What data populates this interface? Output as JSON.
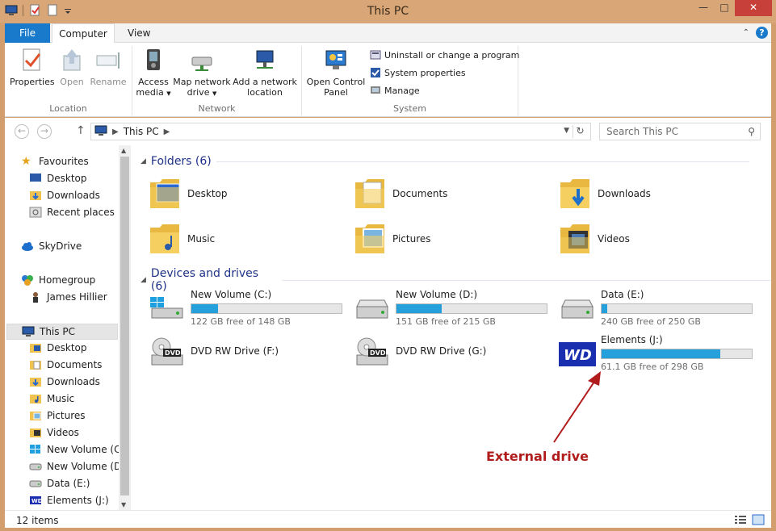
{
  "window": {
    "title": "This PC"
  },
  "ribbon_tabs": {
    "file": "File",
    "computer": "Computer",
    "view": "View"
  },
  "ribbon": {
    "location": {
      "label": "Location",
      "properties": "Properties",
      "open": "Open",
      "rename": "Rename"
    },
    "network": {
      "label": "Network",
      "access_media_1": "Access",
      "access_media_2": "media",
      "map_drive_1": "Map network",
      "map_drive_2": "drive",
      "add_location_1": "Add a network",
      "add_location_2": "location"
    },
    "system": {
      "label": "System",
      "open_cp_1": "Open Control",
      "open_cp_2": "Panel",
      "uninstall": "Uninstall or change a program",
      "sysprops": "System properties",
      "manage": "Manage"
    }
  },
  "address": {
    "path": "This PC",
    "search_placeholder": "Search This PC"
  },
  "nav": {
    "favourites": "Favourites",
    "fav_desktop": "Desktop",
    "fav_downloads": "Downloads",
    "fav_recent": "Recent places",
    "skydrive": "SkyDrive",
    "homegroup": "Homegroup",
    "user": "James Hillier",
    "thispc": "This PC",
    "pc_desktop": "Desktop",
    "pc_documents": "Documents",
    "pc_downloads": "Downloads",
    "pc_music": "Music",
    "pc_pictures": "Pictures",
    "pc_videos": "Videos",
    "pc_c": "New Volume (C:)",
    "pc_d": "New Volume (D:)",
    "pc_e": "Data (E:)",
    "pc_j": "Elements (J:)"
  },
  "content": {
    "folders_header": "Folders (6)",
    "devices_header": "Devices and drives (6)",
    "folders": [
      "Desktop",
      "Documents",
      "Downloads",
      "Music",
      "Pictures",
      "Videos"
    ],
    "drives": [
      {
        "name": "New Volume (C:)",
        "free": "122 GB free of 148 GB",
        "used_fraction": 0.18
      },
      {
        "name": "New Volume (D:)",
        "free": "151 GB free of 215 GB",
        "used_fraction": 0.3
      },
      {
        "name": "Data (E:)",
        "free": "240 GB free of 250 GB",
        "used_fraction": 0.04
      },
      {
        "name": "DVD RW Drive (F:)"
      },
      {
        "name": "DVD RW Drive (G:)"
      },
      {
        "name": "Elements (J:)",
        "free": "61.1 GB free of 298 GB",
        "used_fraction": 0.79
      }
    ]
  },
  "annotation": "External drive",
  "status": {
    "count": "12 items"
  },
  "colors": {
    "accent": "#1979ca",
    "usage_bar": "#26a0da",
    "annotation": "#b01c1c",
    "titlebar": "#d8a677"
  }
}
